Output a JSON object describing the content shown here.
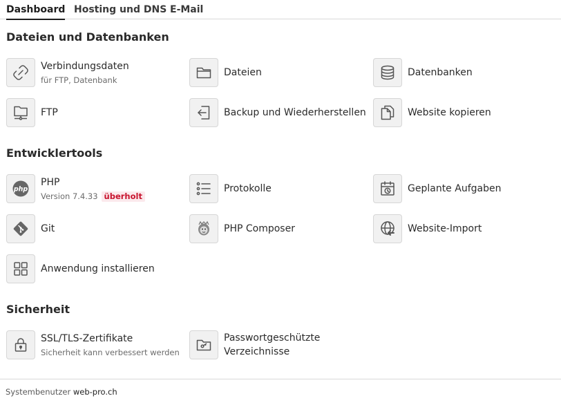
{
  "tabs": [
    "Dashboard",
    "Hosting und DNS",
    "E-Mail"
  ],
  "sections": {
    "files": {
      "title": "Dateien und Datenbanken",
      "connection": {
        "label": "Verbindungsdaten",
        "sub": "für FTP, Datenbank",
        "icon": "link-icon"
      },
      "files": {
        "label": "Dateien",
        "icon": "folder-icon"
      },
      "databases": {
        "label": "Datenbanken",
        "icon": "database-icon"
      },
      "ftp": {
        "label": "FTP",
        "icon": "ftp-icon"
      },
      "backup": {
        "label": "Backup und Wiederherstellen",
        "icon": "backup-icon"
      },
      "copy": {
        "label": "Website kopieren",
        "icon": "copy-icon"
      }
    },
    "dev": {
      "title": "Entwicklertools",
      "php": {
        "label": "PHP",
        "version": "Version 7.4.33",
        "badge": "überholt",
        "icon": "php-icon"
      },
      "logs": {
        "label": "Protokolle",
        "icon": "list-icon"
      },
      "cron": {
        "label": "Geplante Aufgaben",
        "icon": "calendar-clock-icon"
      },
      "git": {
        "label": "Git",
        "icon": "git-icon"
      },
      "composer": {
        "label": "PHP Composer",
        "icon": "composer-icon"
      },
      "import": {
        "label": "Website-Import",
        "icon": "globe-import-icon"
      },
      "install": {
        "label": "Anwendung installieren",
        "icon": "apps-grid-icon"
      }
    },
    "security": {
      "title": "Sicherheit",
      "ssl": {
        "label": "SSL/TLS-Zertifikate",
        "sub": "Sicherheit kann verbessert werden",
        "icon": "lock-icon"
      },
      "protected": {
        "label": "Passwortgeschützte Verzeichnisse",
        "icon": "protected-folder-icon"
      }
    }
  },
  "footer": {
    "label": "Systembenutzer",
    "value": "web-pro.ch"
  },
  "colors": {
    "accent": "#1e1e1e",
    "badge_bg": "#fbe9ec",
    "badge_text": "#c8142e"
  }
}
